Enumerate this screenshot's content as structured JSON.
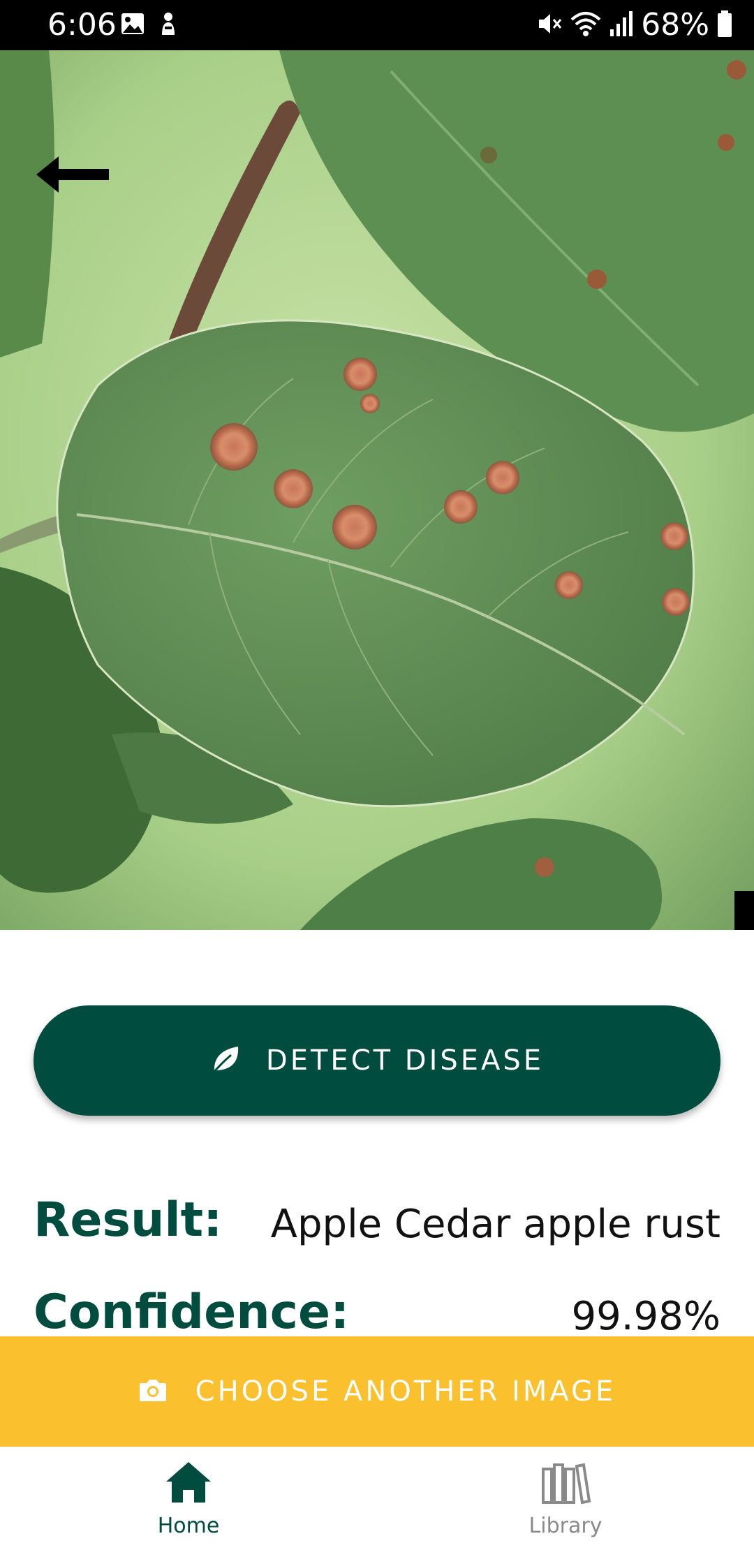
{
  "status_bar": {
    "time": "6:06",
    "battery": "68%",
    "left_icons": [
      "image-icon",
      "notification-icon"
    ],
    "right_icons": [
      "mute-icon",
      "wifi-icon",
      "signal-icon",
      "battery-icon"
    ]
  },
  "hero": {
    "icon": "back-arrow-icon"
  },
  "detect_button": {
    "label": "DETECT DISEASE",
    "icon": "leaf-icon",
    "color": "#004d40"
  },
  "result": {
    "label": "Result:",
    "value": "Apple Cedar apple rust"
  },
  "confidence": {
    "label": "Confidence:",
    "value": "99.98%"
  },
  "choose_button": {
    "label": "CHOOSE ANOTHER IMAGE",
    "icon": "camera-icon",
    "color": "#fbc02d"
  },
  "bottom_nav": {
    "items": [
      {
        "label": "Home",
        "icon": "home-icon",
        "active": true
      },
      {
        "label": "Library",
        "icon": "library-icon",
        "active": false
      }
    ]
  }
}
